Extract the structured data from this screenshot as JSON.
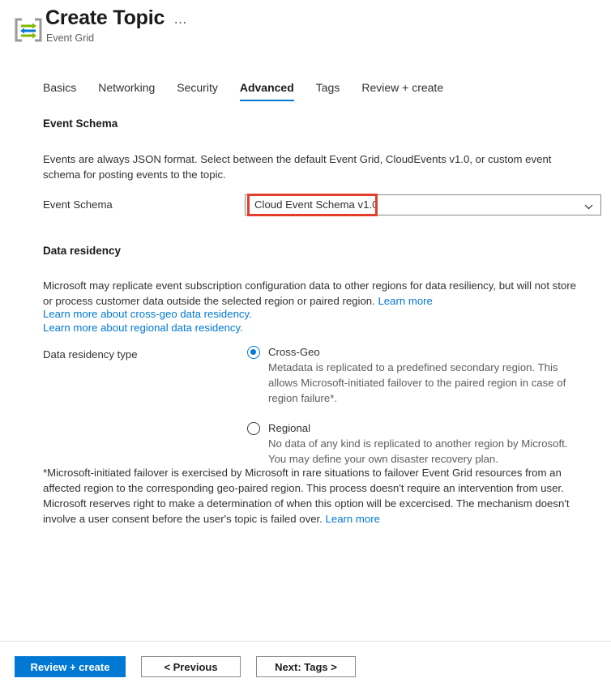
{
  "header": {
    "title": "Create Topic",
    "subtitle": "Event Grid",
    "ellipsis": "⋯",
    "icon_name": "event-grid-icon"
  },
  "tabs": [
    {
      "label": "Basics",
      "active": false
    },
    {
      "label": "Networking",
      "active": false
    },
    {
      "label": "Security",
      "active": false
    },
    {
      "label": "Advanced",
      "active": true
    },
    {
      "label": "Tags",
      "active": false
    },
    {
      "label": "Review + create",
      "active": false
    }
  ],
  "event_schema": {
    "heading": "Event Schema",
    "description": "Events are always JSON format. Select between the default Event Grid, CloudEvents v1.0, or custom event schema for posting events to the topic.",
    "field_label": "Event Schema",
    "selected_value": "Cloud Event Schema v1.0"
  },
  "data_residency": {
    "heading": "Data residency",
    "description": "Microsoft may replicate event subscription configuration data to other regions for data resiliency, but will not store or process customer data outside the selected region or paired region.",
    "description_link": "Learn more",
    "link_cross_geo": "Learn more about cross-geo data residency.",
    "link_regional": "Learn more about regional data residency.",
    "type_label": "Data residency type",
    "options": [
      {
        "label": "Cross-Geo",
        "description": "Metadata is replicated to a predefined secondary region. This allows Microsoft-initiated failover to the paired region in case of region failure*.",
        "selected": true
      },
      {
        "label": "Regional",
        "description": "No data of any kind is replicated to another region by Microsoft. You may define your own disaster recovery plan.",
        "selected": false
      }
    ]
  },
  "footnote": {
    "text": "*Microsoft-initiated failover is exercised by Microsoft in rare situations to failover Event Grid resources from an affected region to the corresponding geo-paired region. This process doesn't require an intervention from user. Microsoft reserves right to make a determination of when this option will be excercised. The mechanism doesn't involve a user consent before the user's topic is failed over.",
    "link": "Learn more"
  },
  "footer": {
    "review_create": "Review + create",
    "previous": "< Previous",
    "next": "Next: Tags >"
  },
  "colors": {
    "accent": "#0078d4",
    "highlight_box": "#e33d2c",
    "link": "#0078d4",
    "text": "#323130",
    "muted": "#605e5c"
  }
}
